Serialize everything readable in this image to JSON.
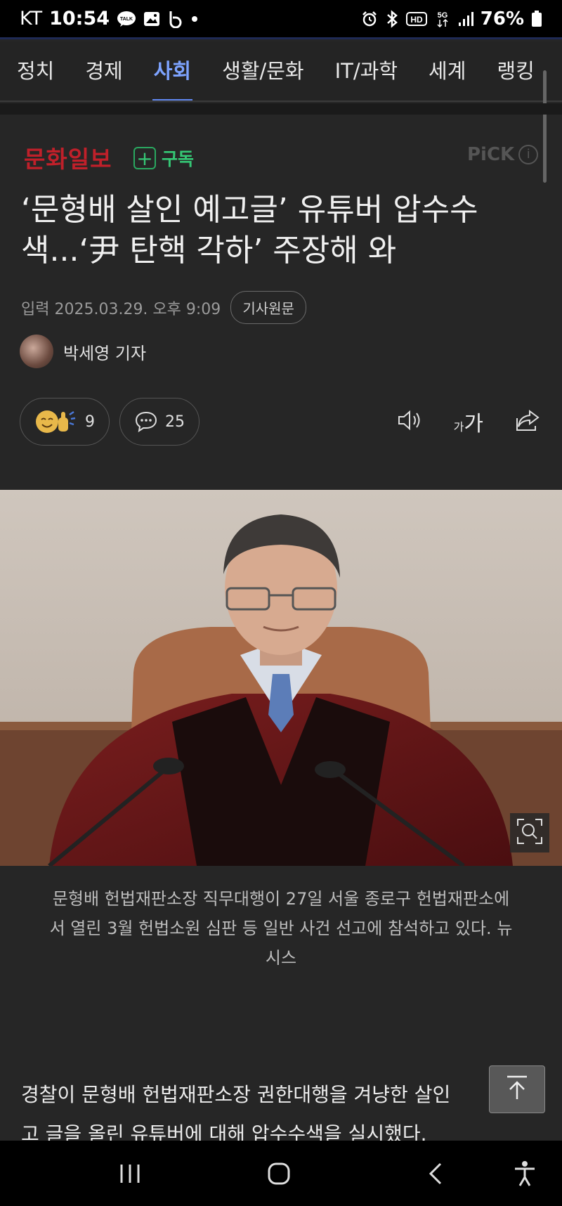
{
  "status_bar": {
    "carrier": "KT",
    "time": "10:54",
    "battery": "76%",
    "left_icons": [
      "talk-icon",
      "gallery-icon",
      "b-app-icon",
      "dot-icon"
    ],
    "right_icons": [
      "alarm-icon",
      "bluetooth-icon",
      "hd-icon",
      "5g-icon",
      "signal-icon",
      "battery-icon"
    ]
  },
  "tabs": [
    {
      "label": "정치",
      "active": false
    },
    {
      "label": "경제",
      "active": false
    },
    {
      "label": "사회",
      "active": true
    },
    {
      "label": "생활/문화",
      "active": false
    },
    {
      "label": "IT/과학",
      "active": false
    },
    {
      "label": "세계",
      "active": false
    },
    {
      "label": "랭킹",
      "active": false
    }
  ],
  "publisher": {
    "name": "문화일보",
    "subscribe_label": "구독",
    "pick_label": "PiCK"
  },
  "article": {
    "headline_line1": "‘문형배 살인 예고글’ 유튜버 압수수",
    "headline_line2": "색...‘尹 탄핵 각하’ 주장해 와",
    "date": "입력 2025.03.29. 오후 9:09",
    "original_button": "기사원문",
    "author": "박세영 기자",
    "reaction_count": "9",
    "comment_count": "25",
    "fontsize_label_small": "가",
    "fontsize_label_large": "가",
    "caption_line1": "문형배 헌법재판소장 직무대행이 27일 서울 종로구 헌법재판소에",
    "caption_line2": "서 열린 3월 헌법소원 심판 등 일반 사건 선고에 참석하고 있다. 뉴",
    "caption_line3": "시스",
    "body_line1": "경찰이 문형배 헌법재판소장 권한대행을 겨냥한 살인",
    "body_line2": "고 글을 올린 유튜버에 대해 압수수색을 실시했다."
  },
  "colors": {
    "background": "#262626",
    "accent": "#7da3ff",
    "publisher_red": "#c0202a",
    "subscribe_green": "#35c775"
  }
}
